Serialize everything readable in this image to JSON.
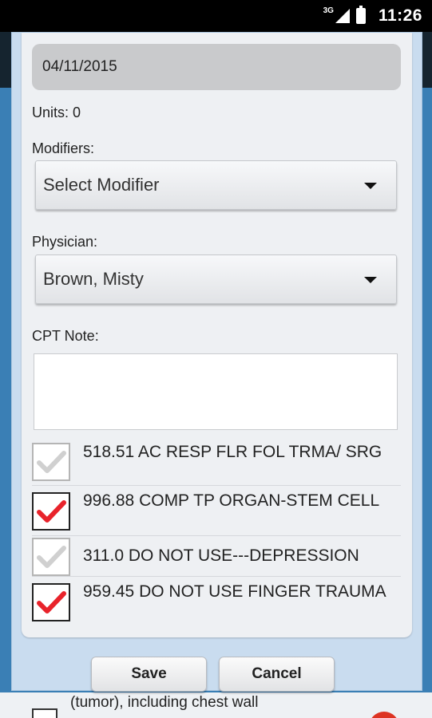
{
  "status_bar": {
    "network": "3G",
    "battery_label": "",
    "time": "11:26"
  },
  "form": {
    "date_value": "04/11/2015",
    "units_label": "Units: 0",
    "modifiers_label": "Modifiers:",
    "modifier_selected": "Select Modifier",
    "physician_label": "Physician:",
    "physician_selected": "Brown, Misty",
    "cpt_note_label": "CPT Note:",
    "cpt_note_value": ""
  },
  "diagnoses": [
    {
      "text": "518.51 AC RESP FLR FOL TRMA/ SRG",
      "checked": false
    },
    {
      "text": "996.88 COMP TP ORGAN-STEM CELL",
      "checked": true
    },
    {
      "text": "311.0 DO NOT USE---DEPRESSION",
      "checked": false
    },
    {
      "text": "959.45 DO NOT USE FINGER TRAUMA",
      "checked": true
    }
  ],
  "buttons": {
    "save": "Save",
    "cancel": "Cancel"
  },
  "background": {
    "partial_text": "(tumor), including chest wall"
  },
  "colors": {
    "check_on": "#e8232b",
    "check_off": "#d0d0d0",
    "dialog_bg": "#c9dcef"
  }
}
